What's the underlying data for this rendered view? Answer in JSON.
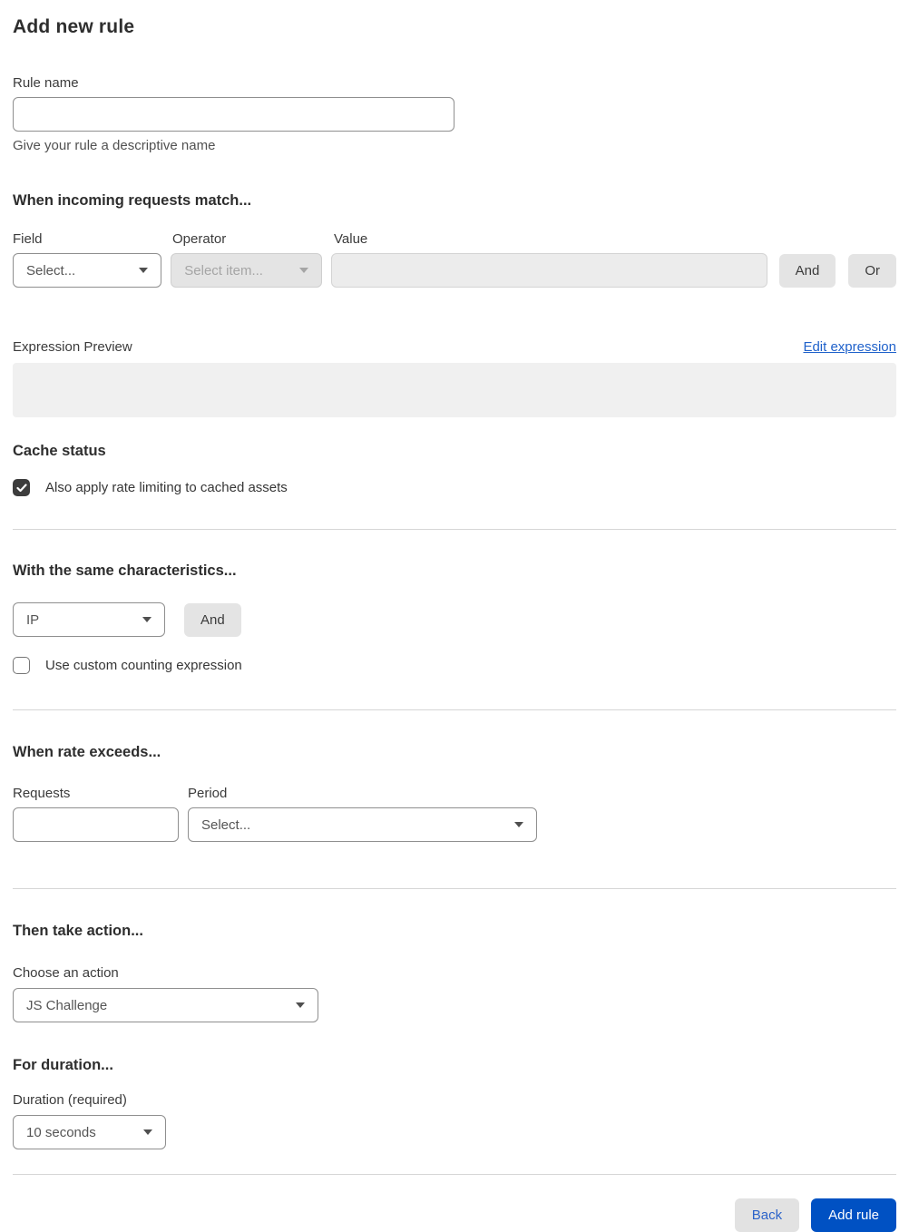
{
  "page": {
    "title": "Add new rule"
  },
  "rule_name": {
    "label": "Rule name",
    "value": "",
    "helper": "Give your rule a descriptive name"
  },
  "match_section": {
    "heading": "When incoming requests match...",
    "field": {
      "label": "Field",
      "selected": "Select..."
    },
    "operator": {
      "label": "Operator",
      "selected": "Select item...",
      "disabled": true
    },
    "value": {
      "label": "Value",
      "value": "",
      "disabled": true
    },
    "and_button": "And",
    "or_button": "Or",
    "expression_preview": {
      "label": "Expression Preview",
      "edit_link": "Edit expression",
      "content": ""
    }
  },
  "cache_status": {
    "heading": "Cache status",
    "checkbox_label": "Also apply rate limiting to cached assets",
    "checked": true
  },
  "characteristics_section": {
    "heading": "With the same characteristics...",
    "characteristic_selected": "IP",
    "and_button": "And",
    "custom_counting": {
      "label": "Use custom counting expression",
      "checked": false
    }
  },
  "rate_section": {
    "heading": "When rate exceeds...",
    "requests": {
      "label": "Requests",
      "value": ""
    },
    "period": {
      "label": "Period",
      "selected": "Select..."
    }
  },
  "action_section": {
    "heading": "Then take action...",
    "action": {
      "label": "Choose an action",
      "selected": "JS Challenge"
    }
  },
  "duration_section": {
    "heading": "For duration...",
    "duration": {
      "label": "Duration (required)",
      "selected": "10 seconds"
    }
  },
  "footer": {
    "back_button": "Back",
    "add_rule_button": "Add rule"
  },
  "icons": {
    "dropdown_chevron": "chevron-down-icon",
    "checkmark": "checkmark-icon"
  },
  "colors": {
    "primary_button": "#0051c3",
    "link": "#2062cb",
    "checked_checkbox": "#3d3d3d",
    "divider": "#d6d6d6",
    "preview_box": "#f0f0f0"
  }
}
